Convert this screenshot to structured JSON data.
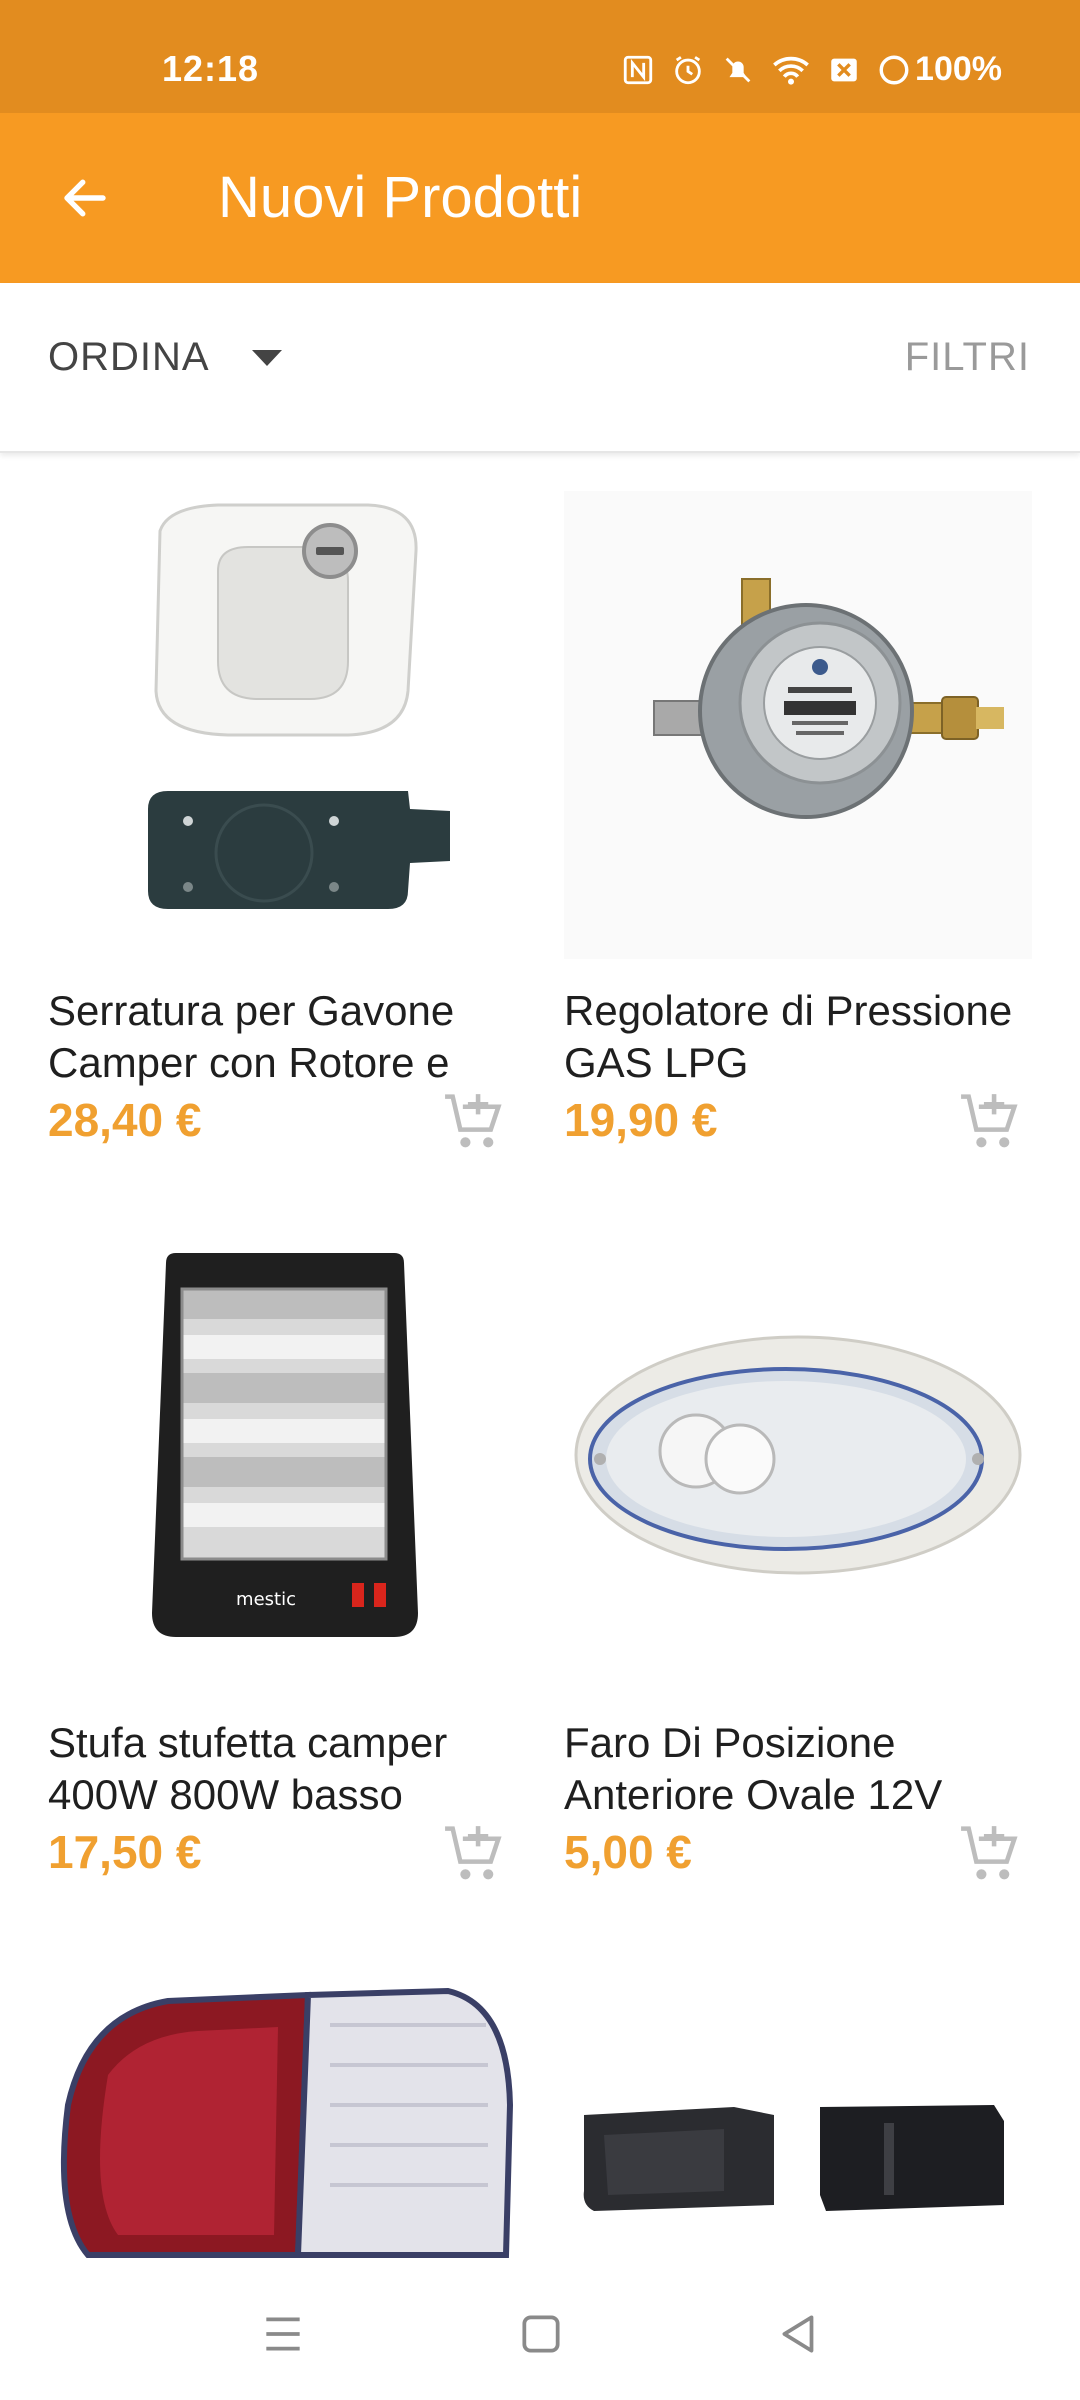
{
  "status_bar": {
    "time": "12:18",
    "battery": "100%",
    "icons": [
      "nfc-icon",
      "alarm-icon",
      "mute-icon",
      "wifi-icon",
      "sim-off-icon",
      "battery-icon"
    ]
  },
  "app_bar": {
    "title": "Nuovi Prodotti",
    "back_icon": "arrow-back-icon"
  },
  "sort_bar": {
    "sort_label": "ORDINA",
    "filter_label": "FILTRI"
  },
  "products": [
    {
      "name": "Serratura per Gavone Camper con Rotore e",
      "price": "28,40 €",
      "image": "compartment-lock-image"
    },
    {
      "name": "Regolatore di Pressione GAS LPG",
      "price": "19,90 €",
      "image": "gas-regulator-image"
    },
    {
      "name": "Stufa stufetta camper 400W 800W basso",
      "price": "17,50 €",
      "image": "heater-image",
      "image_text": "mestic"
    },
    {
      "name": "Faro Di Posizione Anteriore Ovale 12V",
      "price": "5,00 €",
      "image": "oval-light-image"
    },
    {
      "name": "",
      "price": "",
      "image": "rear-lamp-image"
    },
    {
      "name": "",
      "price": "",
      "image": "black-clips-image"
    }
  ],
  "colors": {
    "status_bar": "#e28c1f",
    "app_bar": "#f79a22",
    "price": "#f0a030"
  }
}
